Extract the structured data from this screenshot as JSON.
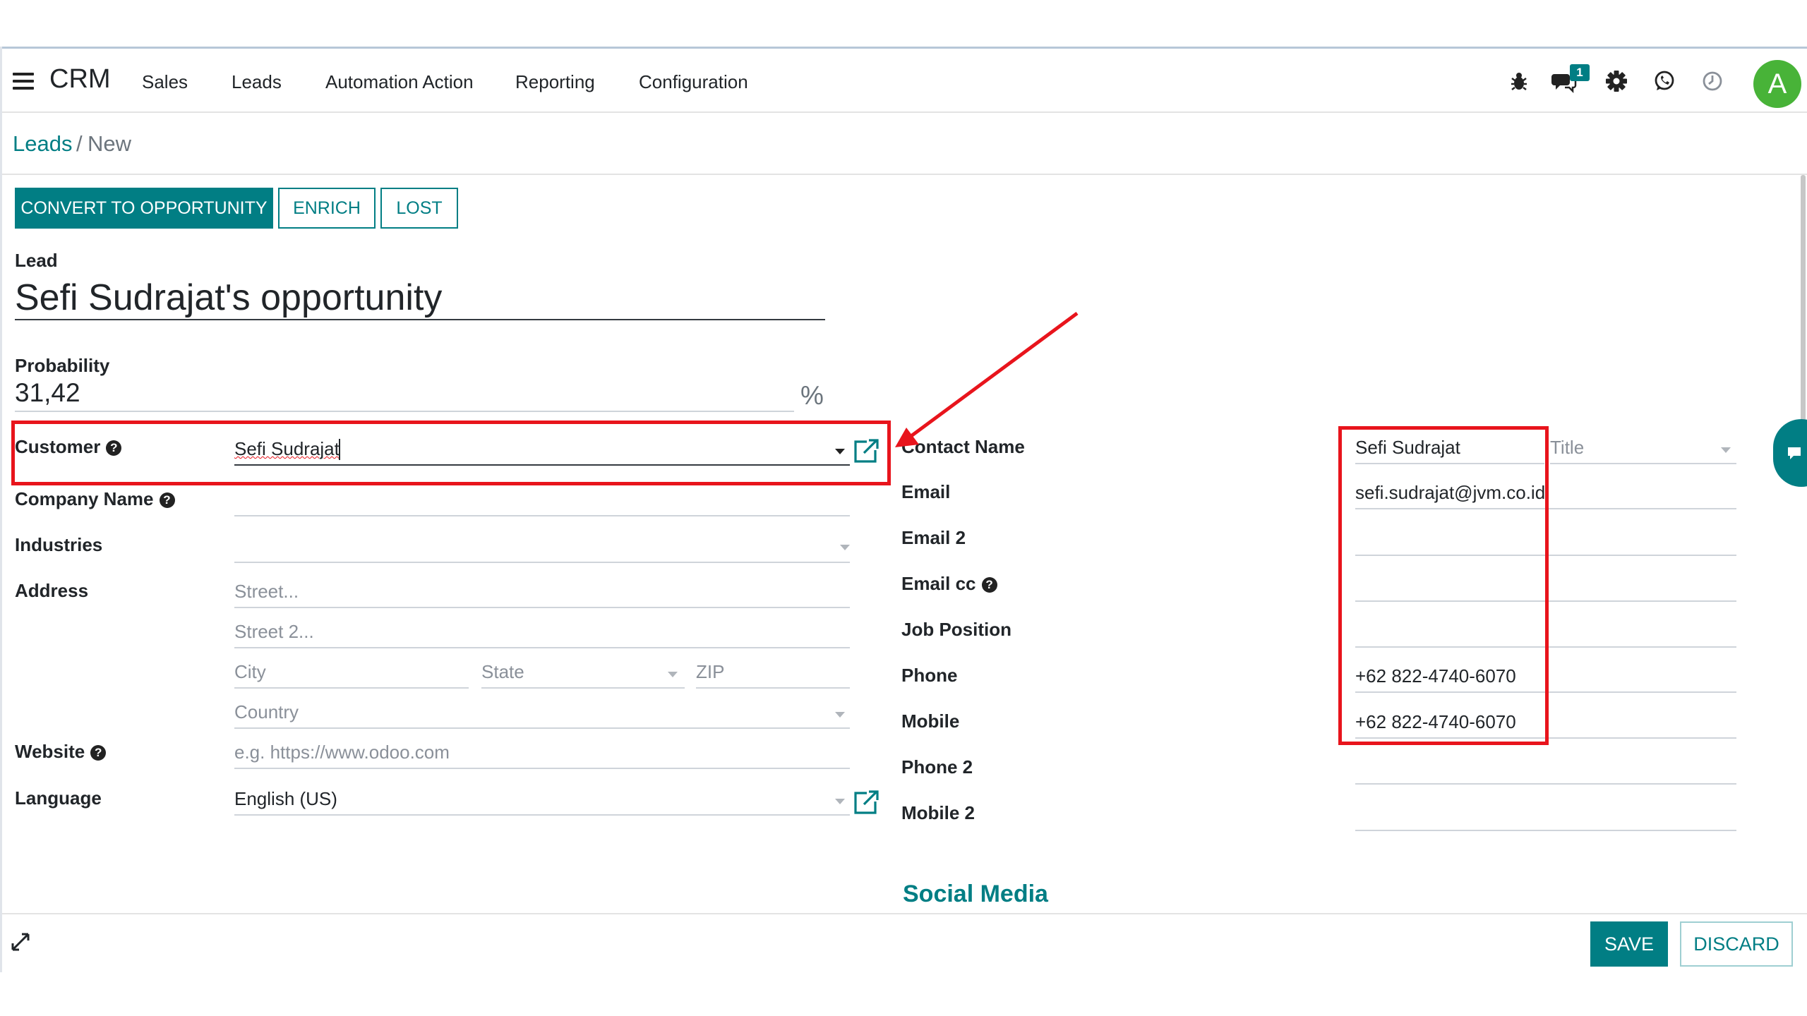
{
  "nav": {
    "app_title": "CRM",
    "items": [
      "Sales",
      "Leads",
      "Automation Action",
      "Reporting",
      "Configuration"
    ],
    "messages_badge": "1",
    "avatar_letter": "A",
    "icons": [
      "menu-icon",
      "bug-icon",
      "chat-icon",
      "gear-icon",
      "whatsapp-icon",
      "clock-icon"
    ]
  },
  "breadcrumb": {
    "parent": "Leads",
    "separator": "/",
    "current": "New"
  },
  "actions": {
    "convert": "CONVERT TO OPPORTUNITY",
    "enrich": "ENRICH",
    "lost": "LOST"
  },
  "form": {
    "type_label": "Lead",
    "name": "Sefi Sudrajat's opportunity",
    "probability_label": "Probability",
    "probability_value": "31,42",
    "probability_unit": "%",
    "customer_label": "Customer",
    "customer_value": "Sefi Sudrajat",
    "company_label": "Company Name",
    "industries_label": "Industries",
    "address_label": "Address",
    "street_placeholder": "Street...",
    "street2_placeholder": "Street 2...",
    "city_placeholder": "City",
    "state_placeholder": "State",
    "zip_placeholder": "ZIP",
    "country_placeholder": "Country",
    "website_label": "Website",
    "website_placeholder": "e.g. https://www.odoo.com",
    "language_label": "Language",
    "language_value": "English (US)"
  },
  "contact": {
    "contact_name_label": "Contact Name",
    "contact_name_value": "Sefi Sudrajat",
    "title_placeholder": "Title",
    "email_label": "Email",
    "email_value": "sefi.sudrajat@jvm.co.id",
    "email2_label": "Email 2",
    "emailcc_label": "Email cc",
    "job_label": "Job Position",
    "phone_label": "Phone",
    "phone_value": "+62 822-4740-6070",
    "mobile_label": "Mobile",
    "mobile_value": "+62 822-4740-6070",
    "phone2_label": "Phone 2",
    "mobile2_label": "Mobile 2"
  },
  "section_social": "Social Media",
  "footer": {
    "save": "SAVE",
    "discard": "DISCARD"
  },
  "colors": {
    "primary": "#017e84",
    "annotation": "#e8141c",
    "avatar": "#48b338"
  }
}
